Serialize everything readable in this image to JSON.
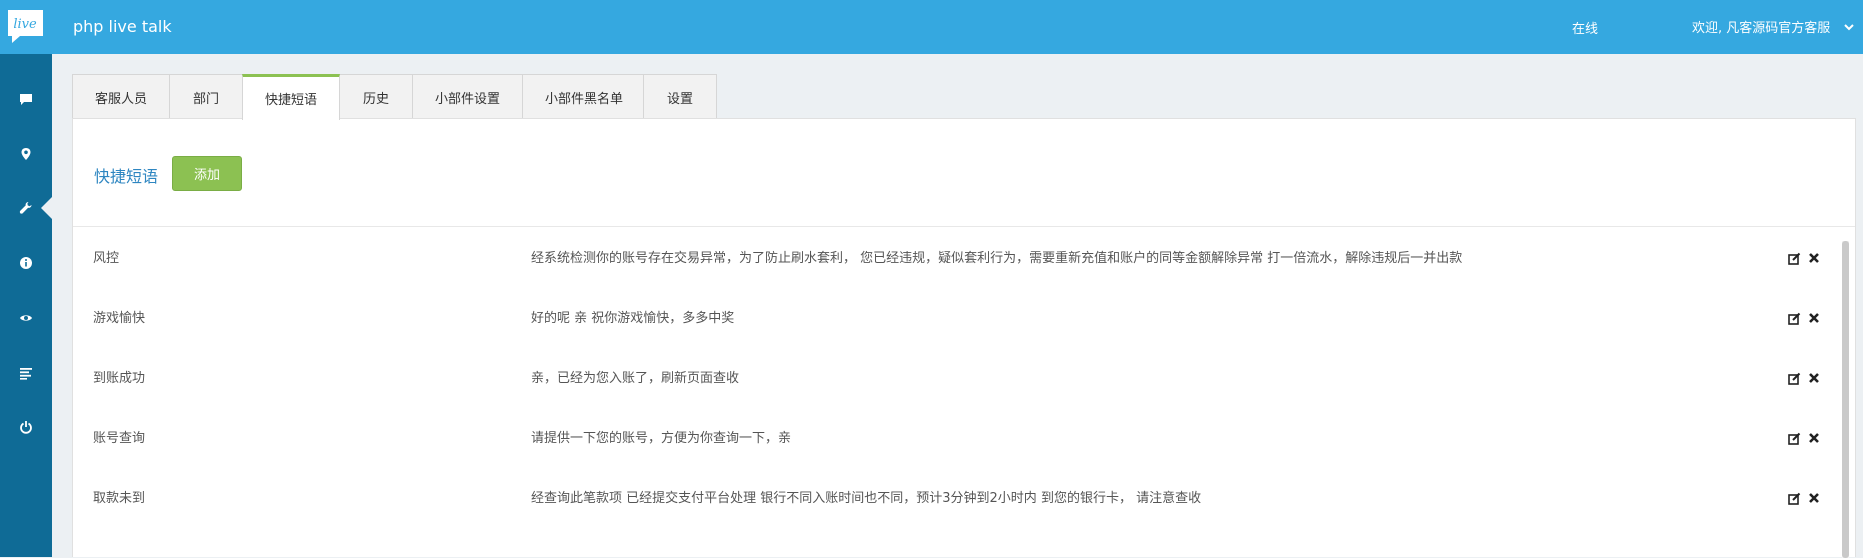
{
  "header": {
    "logo_text": "live",
    "app_title": "php live talk",
    "status": "在线",
    "welcome": "欢迎, 凡客源码官方客服"
  },
  "sidebar": {
    "items": [
      {
        "icon": "chat-bubble-icon"
      },
      {
        "icon": "map-marker-icon"
      },
      {
        "icon": "wrench-icon",
        "active": true
      },
      {
        "icon": "info-icon"
      },
      {
        "icon": "eye-icon"
      },
      {
        "icon": "list-icon"
      },
      {
        "icon": "power-icon"
      }
    ]
  },
  "tabs": [
    {
      "label": "客服人员"
    },
    {
      "label": "部门"
    },
    {
      "label": "快捷短语",
      "active": true
    },
    {
      "label": "历史"
    },
    {
      "label": "小部件设置"
    },
    {
      "label": "小部件黑名单"
    },
    {
      "label": "设置"
    }
  ],
  "panel": {
    "title": "快捷短语",
    "add_label": "添加"
  },
  "phrases": [
    {
      "name": "风控",
      "text": "经系统检测你的账号存在交易异常，为了防止刷水套利， 您已经违规，疑似套利行为，需要重新充值和账户的同等金额解除异常 打一倍流水，解除违规后一并出款"
    },
    {
      "name": "游戏愉快",
      "text": "好的呢 亲 祝你游戏愉快，多多中奖"
    },
    {
      "name": "到账成功",
      "text": "亲，已经为您入账了，刷新页面查收"
    },
    {
      "name": "账号查询",
      "text": "请提供一下您的账号，方便为你查询一下，亲"
    },
    {
      "name": "取款未到",
      "text": "经查询此笔款项 已经提交支付平台处理 银行不同入账时间也不同，预计3分钟到2小时内 到您的银行卡， 请注意查收"
    }
  ],
  "colors": {
    "topbar": "#35a8e0",
    "sidebar": "#0f6b96",
    "accent_green": "#8cc152",
    "title_blue": "#2e86c1"
  }
}
